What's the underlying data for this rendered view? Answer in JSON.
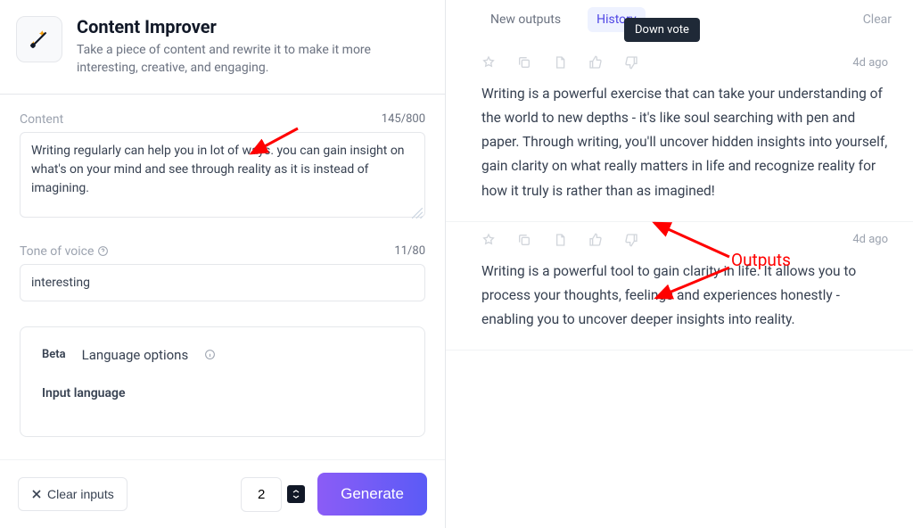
{
  "header": {
    "title": "Content Improver",
    "subtitle": "Take a piece of content and rewrite it to make it more interesting, creative, and engaging."
  },
  "content_field": {
    "label": "Content",
    "count": "145/800",
    "value": "Writing regularly can help you in lot of ways. you can gain insight on what's on your mind and see through reality as it is instead of imagining."
  },
  "tone_field": {
    "label": "Tone of voice",
    "count": "11/80",
    "value": "interesting"
  },
  "language_box": {
    "badge": "Beta",
    "title": "Language options",
    "input_label": "Input language"
  },
  "bottom": {
    "clear_label": "Clear inputs",
    "count_value": "2",
    "generate_label": "Generate"
  },
  "tabs": {
    "new_outputs": "New outputs",
    "history": "History",
    "clear": "Clear"
  },
  "tooltip": "Down vote",
  "outputs": [
    {
      "time": "4d ago",
      "text": "Writing is a powerful exercise that can take your understanding of the world to new depths - it's like soul searching with pen and paper. Through writing, you'll uncover hidden insights into yourself, gain clarity on what really matters in life and recognize reality for how it truly is rather than as imagined!"
    },
    {
      "time": "4d ago",
      "text": "Writing is a powerful tool to gain clarity in life. It allows you to process your thoughts, feelings and experiences honestly - enabling you to uncover deeper insights into reality."
    }
  ],
  "annotation": {
    "outputs_label": "Outputs"
  }
}
